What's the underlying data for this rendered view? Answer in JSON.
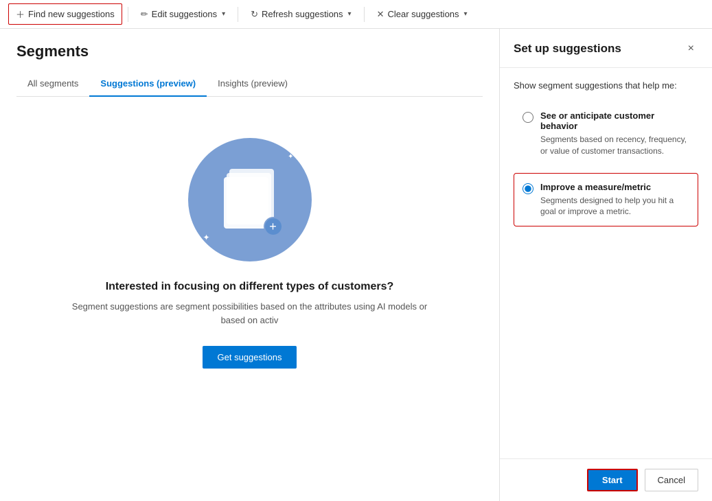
{
  "toolbar": {
    "find_new_label": "Find new suggestions",
    "edit_label": "Edit suggestions",
    "refresh_label": "Refresh suggestions",
    "clear_label": "Clear suggestions"
  },
  "page": {
    "title": "Segments",
    "tabs": [
      {
        "id": "all",
        "label": "All segments",
        "active": false
      },
      {
        "id": "suggestions",
        "label": "Suggestions (preview)",
        "active": true
      },
      {
        "id": "insights",
        "label": "Insights (preview)",
        "active": false
      }
    ]
  },
  "content": {
    "heading": "Interested in focusing on different types of customers?",
    "description": "Segment suggestions are segment possibilities based on the attributes using AI models or based on activ",
    "get_suggestions_label": "Get suggestions"
  },
  "right_panel": {
    "title": "Set up suggestions",
    "subtitle": "Show segment suggestions that help me:",
    "close_icon": "×",
    "options": [
      {
        "id": "behavior",
        "label": "See or anticipate customer behavior",
        "description": "Segments based on recency, frequency, or value of customer transactions.",
        "selected": false
      },
      {
        "id": "metric",
        "label": "Improve a measure/metric",
        "description": "Segments designed to help you hit a goal or improve a metric.",
        "selected": true
      }
    ],
    "footer": {
      "start_label": "Start",
      "cancel_label": "Cancel"
    }
  }
}
